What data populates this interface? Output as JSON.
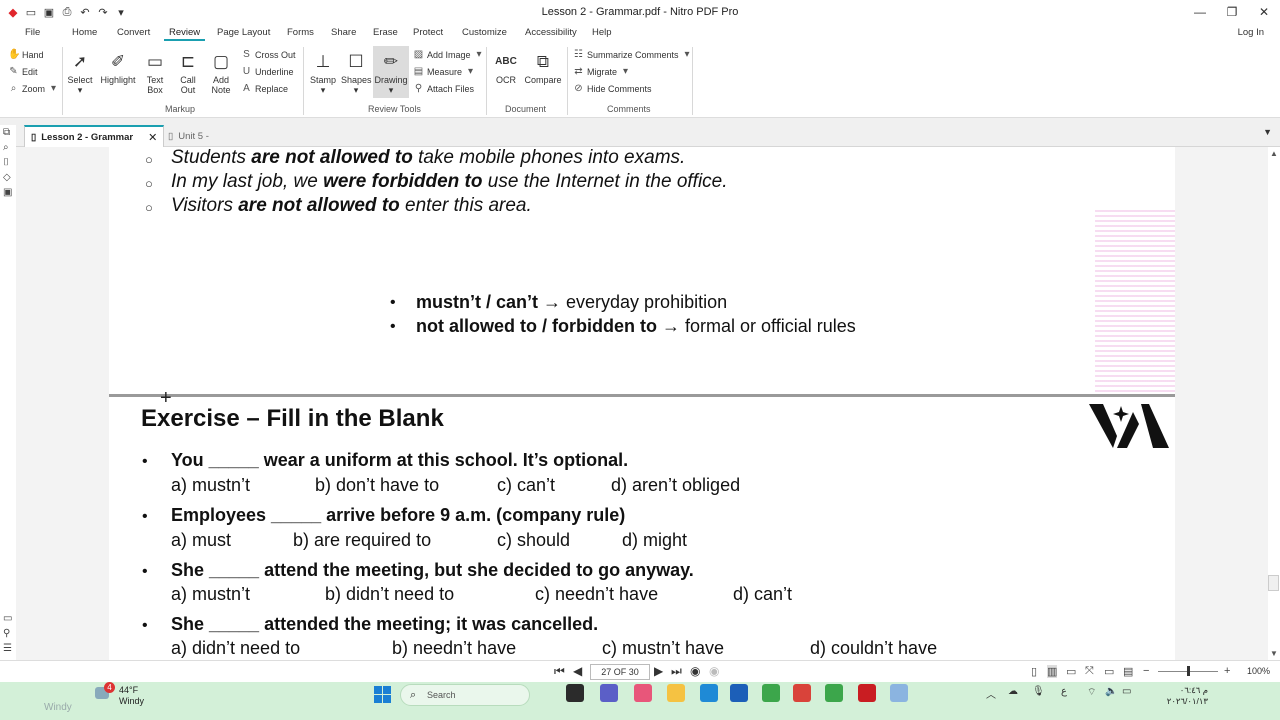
{
  "window": {
    "title": "Lesson 2 -  Grammar.pdf - Nitro PDF Pro"
  },
  "menu": {
    "items": [
      "File",
      "Home",
      "Convert",
      "Review",
      "Page Layout",
      "Forms",
      "Share",
      "Erase",
      "Protect",
      "Customize",
      "Accessibility",
      "Help"
    ],
    "active": "Review",
    "login": "Log In"
  },
  "ribbon": {
    "nav": {
      "hand": "Hand",
      "edit": "Edit",
      "zoom": "Zoom"
    },
    "markup": {
      "select": "Select",
      "highlight": "Highlight",
      "text_box_1": "Text",
      "text_box_2": "Box",
      "call_out_1": "Call",
      "call_out_2": "Out",
      "add_note_1": "Add",
      "add_note_2": "Note",
      "cross_out": "Cross Out",
      "underline": "Underline",
      "replace": "Replace",
      "label": "Markup"
    },
    "review_tools": {
      "stamp": "Stamp",
      "shapes": "Shapes",
      "drawing": "Drawing",
      "add_image": "Add Image",
      "measure": "Measure",
      "attach_files": "Attach Files",
      "label": "Review Tools"
    },
    "document": {
      "ocr": "OCR",
      "compare": "Compare",
      "label": "Document"
    },
    "comments": {
      "summarize": "Summarize Comments",
      "migrate": "Migrate",
      "hide": "Hide Comments",
      "label": "Comments"
    }
  },
  "tabs": [
    {
      "label": "Lesson 2 -  Grammar"
    },
    {
      "label": "Unit 5 -"
    }
  ],
  "page1": {
    "examples": [
      {
        "pre": "Students ",
        "bold": "are not allowed to",
        "post": " take mobile phones into exams."
      },
      {
        "pre": "In my last job, we ",
        "bold": "were forbidden to",
        "post": " use the Internet in the office."
      },
      {
        "pre": "Visitors ",
        "bold": "are not allowed to",
        "post": " enter this area."
      }
    ],
    "rules": [
      {
        "bold": "mustn’t / can’t",
        "rest": " → everyday prohibition"
      },
      {
        "bold": "not allowed to / forbidden to",
        "rest": " → formal or official rules"
      }
    ]
  },
  "page2": {
    "heading": "Exercise – Fill in the Blank",
    "questions": [
      {
        "text": "You _____ wear a uniform at this school. It’s optional.",
        "options": [
          "a) mustn’t",
          "b) don’t have to",
          "c) can’t",
          "d) aren’t obliged"
        ]
      },
      {
        "text": "Employees _____ arrive before 9 a.m. (company rule)",
        "options": [
          "a) must",
          "b) are required to",
          "c) should",
          "d) might"
        ]
      },
      {
        "text": "She _____ attend the meeting, but she decided to go anyway.",
        "options": [
          "a) mustn’t",
          "b) didn’t need to",
          "c) needn’t have",
          "d) can’t"
        ]
      },
      {
        "text": "She _____ attended the meeting; it was cancelled.",
        "options": [
          "a) didn’t need to",
          "b) needn’t have",
          "c) mustn’t have",
          "d) couldn’t have"
        ]
      }
    ]
  },
  "statusbar": {
    "page_field": "27 OF 30",
    "zoom": "100%"
  },
  "taskbar": {
    "weather_temp": "44°F",
    "weather_label": "Windy",
    "weather_badge": "4",
    "faded_label": "Windy",
    "search_placeholder": "Search",
    "clock_time": "م ٠٦:٤٦",
    "clock_date": "٢٠٢٦/٠١/١٣",
    "lang": "ع"
  },
  "colors": {
    "accent": "#1a9fb0",
    "taskbar": "#d3f0d8",
    "viewer_bg": "#f3f3f3"
  }
}
